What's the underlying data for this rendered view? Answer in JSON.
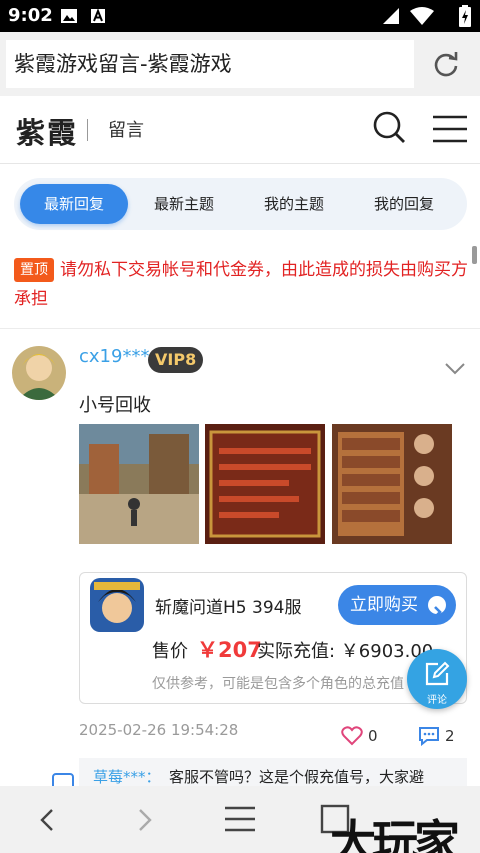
{
  "status_bar": {
    "time": "9:02"
  },
  "browser": {
    "url_title": "紫霞游戏留言-紫霞游戏"
  },
  "header": {
    "logo": "紫霞",
    "subtitle": "留言"
  },
  "tabs": [
    {
      "label": "最新回复",
      "active": true
    },
    {
      "label": "最新主题",
      "active": false
    },
    {
      "label": "我的主题",
      "active": false
    },
    {
      "label": "我的回复",
      "active": false
    }
  ],
  "notice": {
    "badge": "置顶",
    "text": "请勿私下交易帐号和代金券，由此造成的损失由购买方承担"
  },
  "post": {
    "username": "cx19***",
    "vip": "VIP8",
    "text": "小号回收",
    "product": {
      "game_name": "斩魔问道H5 394服",
      "buy_label": "立即购买",
      "price_label": "售价",
      "price": "￥207",
      "recharge": "实际充值: ￥6903.00",
      "disclaimer": "仅供参考，可能是包含多个角色的总充值"
    },
    "time": "2025-02-26 19:54:28",
    "likes": "0",
    "comments": "2",
    "reply": {
      "user": "草莓***：",
      "text": "客服不管吗？这是个假充值号，大家避"
    }
  },
  "fab": {
    "label": "评论"
  },
  "watermark": "大玩家",
  "colors": {
    "accent": "#3688e8",
    "price": "#f03a3a",
    "pin": "#f35a1b",
    "notice": "#e22323"
  }
}
